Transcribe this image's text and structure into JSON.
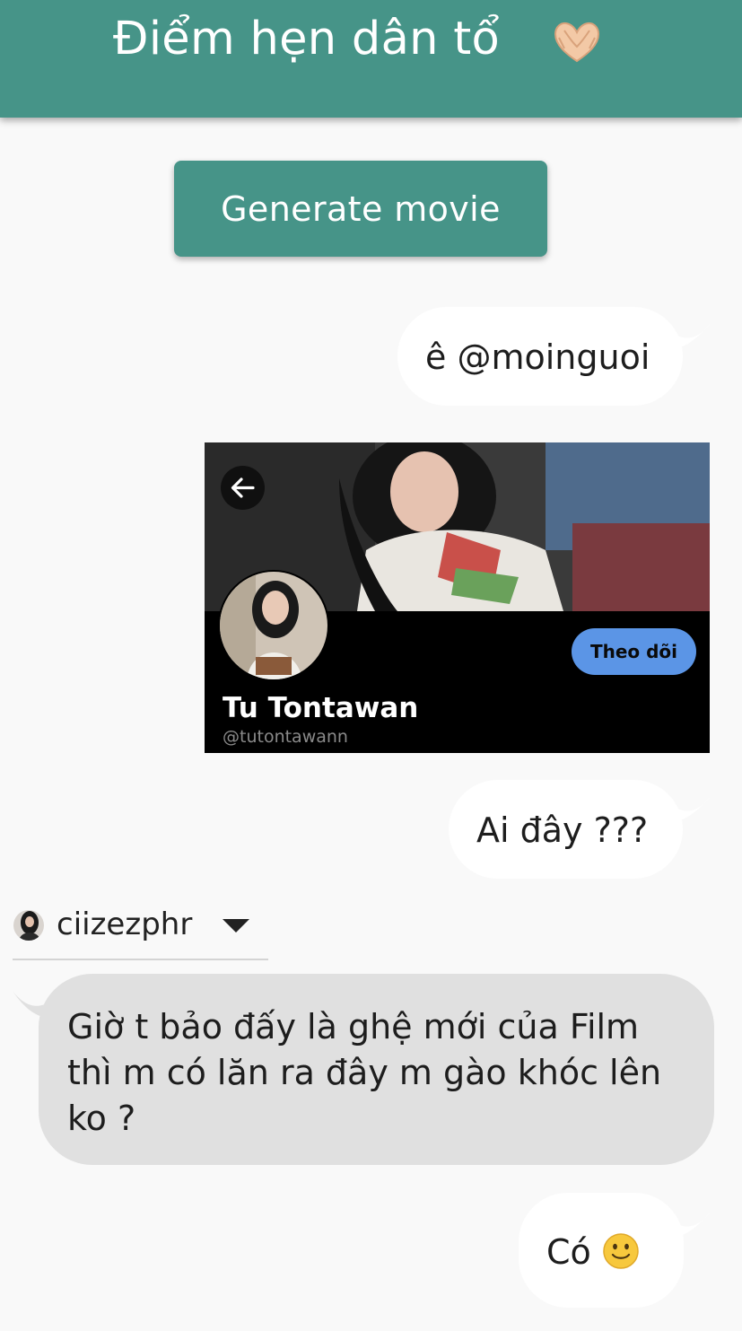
{
  "appbar": {
    "title": "Điểm hẹn dân tổ",
    "title_icon": "heart-hands-emoji",
    "color": "#469488"
  },
  "actions": {
    "generate_label": "Generate movie"
  },
  "messages": [
    {
      "side": "right",
      "text": "ê @moinguoi"
    },
    {
      "side": "right",
      "type": "profile-card",
      "card": {
        "name": "Tu Tontawan",
        "handle": "@tutontawann",
        "follow_label": "Theo dõi",
        "back_icon": "arrow-left-icon"
      }
    },
    {
      "side": "right",
      "text": "Ai đây ???"
    },
    {
      "side": "left",
      "text": "Giờ t bảo đấy là ghệ mới của Film thì m có lăn ra đây m gào khóc lên ko ?"
    },
    {
      "side": "right",
      "text": "Có",
      "emoji": "slightly-smiling-face-emoji"
    }
  ],
  "user_select": {
    "name": "ciizezphr",
    "icon": "chevron-down-icon"
  },
  "colors": {
    "background": "#f9f9f9",
    "bubble_out": "#ffffff",
    "bubble_in": "#e0e0e0",
    "follow": "#5b95e6"
  }
}
